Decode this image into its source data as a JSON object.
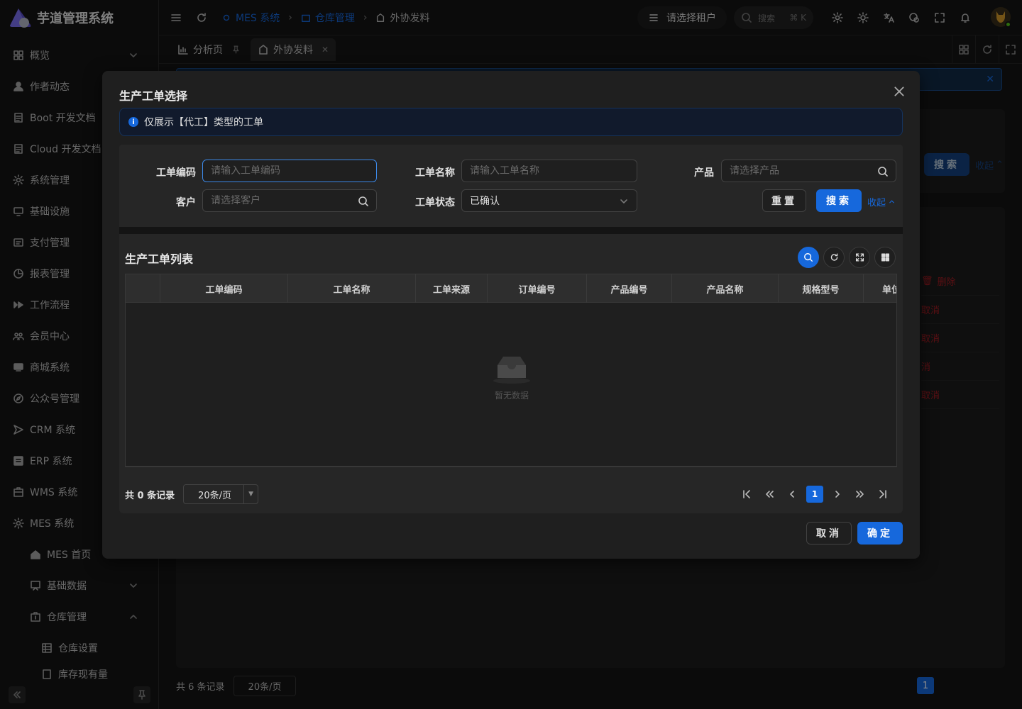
{
  "app": {
    "name": "芋道管理系统"
  },
  "sidebar": {
    "items": [
      {
        "label": "概览",
        "icon": "grid-icon"
      },
      {
        "label": "作者动态",
        "icon": "user-icon"
      },
      {
        "label": "Boot 开发文档",
        "icon": "doc-icon"
      },
      {
        "label": "Cloud 开发文档",
        "icon": "doc-icon"
      },
      {
        "label": "系统管理",
        "icon": "gear-icon"
      },
      {
        "label": "基础设施",
        "icon": "monitor-icon"
      },
      {
        "label": "支付管理",
        "icon": "pay-icon"
      },
      {
        "label": "报表管理",
        "icon": "pie-icon"
      },
      {
        "label": "工作流程",
        "icon": "flow-icon"
      },
      {
        "label": "会员中心",
        "icon": "members-icon"
      },
      {
        "label": "商城系统",
        "icon": "shop-icon"
      },
      {
        "label": "公众号管理",
        "icon": "compass-icon"
      },
      {
        "label": "CRM 系统",
        "icon": "crm-icon"
      },
      {
        "label": "ERP 系统",
        "icon": "erp-icon"
      },
      {
        "label": "WMS 系统",
        "icon": "wms-icon"
      },
      {
        "label": "MES 系统",
        "icon": "gear-icon"
      },
      {
        "label": "MES 首页",
        "icon": "home-icon"
      },
      {
        "label": "基础数据",
        "icon": "board-icon"
      },
      {
        "label": "仓库管理",
        "icon": "warehouse-icon"
      },
      {
        "label": "仓库设置",
        "icon": "table-icon"
      },
      {
        "label": "库存现有量",
        "icon": "doc-icon"
      }
    ]
  },
  "header": {
    "breadcrumb": [
      "MES 系统",
      "仓库管理",
      "外协发料"
    ],
    "tenant": "请选择租户",
    "search_placeholder": "搜索",
    "search_shortcut": "⌘ K"
  },
  "tabs": [
    {
      "label": "分析页"
    },
    {
      "label": "外协发料"
    }
  ],
  "bgpage": {
    "row_actions": [
      "删除",
      "取消",
      "取消",
      "消",
      "取消"
    ],
    "total": "共 6 条记录",
    "page_size": "20条/页",
    "current_page": "1",
    "search_label": "搜索",
    "collapse_label": "收起"
  },
  "modal": {
    "title": "生产工单选择",
    "info": "仅展示【代工】类型的工单",
    "form": {
      "code_label": "工单编码",
      "code_placeholder": "请输入工单编码",
      "name_label": "工单名称",
      "name_placeholder": "请输入工单名称",
      "product_label": "产品",
      "product_placeholder": "请选择产品",
      "customer_label": "客户",
      "customer_placeholder": "请选择客户",
      "status_label": "工单状态",
      "status_value": "已确认",
      "reset": "重置",
      "search": "搜索",
      "collapse": "收起"
    },
    "list": {
      "title": "生产工单列表",
      "columns": [
        "工单编码",
        "工单名称",
        "工单来源",
        "订单编号",
        "产品编号",
        "产品名称",
        "规格型号",
        "单位"
      ],
      "empty": "暂无数据",
      "total": "共 0 条记录",
      "page_size": "20条/页",
      "current_page": "1"
    },
    "cancel": "取消",
    "ok": "确定"
  },
  "colors": {
    "primary": "#1668dc",
    "danger": "#a61d24",
    "bg": "#141414",
    "panel": "#1f1f1f"
  }
}
